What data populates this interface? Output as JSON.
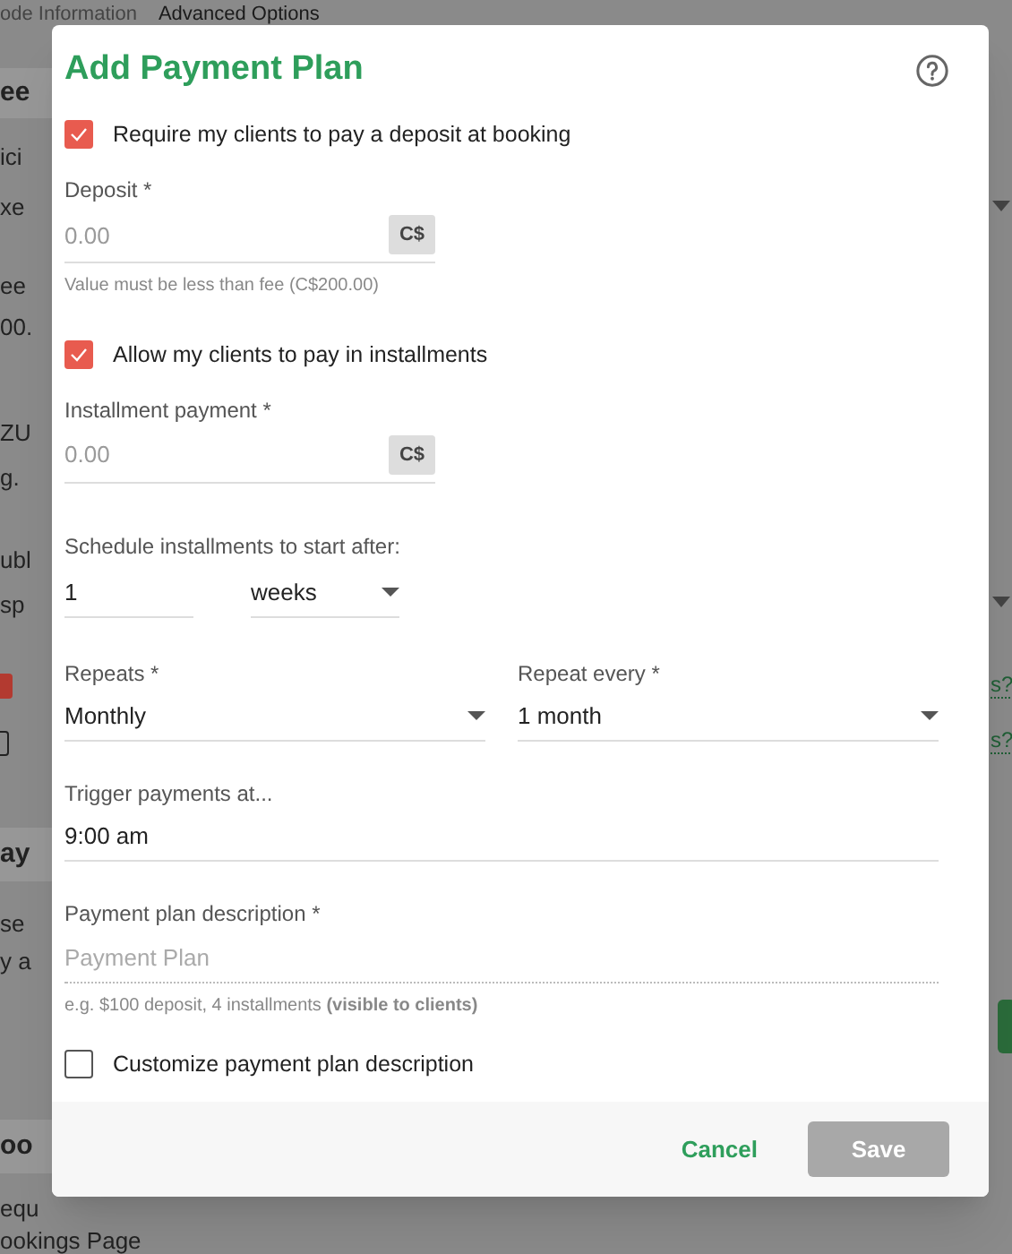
{
  "background": {
    "tabs": [
      {
        "label": "ode Information",
        "selected": false
      },
      {
        "label": "Advanced Options",
        "selected": true
      }
    ],
    "left_fragments": [
      {
        "kind": "heading",
        "text": "ee"
      },
      {
        "kind": "text",
        "text": "ici"
      },
      {
        "kind": "text",
        "text": "xe"
      },
      {
        "kind": "text",
        "text": "ee"
      },
      {
        "kind": "text",
        "text": "00."
      },
      {
        "kind": "text",
        "text": "ZU"
      },
      {
        "kind": "text",
        "text": "g."
      },
      {
        "kind": "text",
        "text": "ubl"
      },
      {
        "kind": "text",
        "text": "sp"
      },
      {
        "kind": "heading",
        "text": "ay"
      },
      {
        "kind": "text",
        "text": "se"
      },
      {
        "kind": "text",
        "text": "y a"
      },
      {
        "kind": "heading",
        "text": "oo"
      },
      {
        "kind": "text",
        "text": "equ"
      },
      {
        "kind": "text",
        "text": "ookings Page"
      }
    ],
    "right_links": [
      "s?",
      "s?"
    ],
    "checkbox": {
      "checked": false
    }
  },
  "dialog": {
    "title": "Add Payment Plan",
    "fields": [
      {
        "kind": "checkbox",
        "label": "Require my clients to pay a deposit at booking",
        "checked": true
      },
      {
        "kind": "money",
        "label": "Deposit *",
        "placeholder": "0.00",
        "currency": "C$",
        "hint": "Value must be less than fee (C$200.00)"
      },
      {
        "kind": "checkbox",
        "label": "Allow my clients to pay in installments",
        "checked": true
      },
      {
        "kind": "money",
        "label": "Installment payment *",
        "placeholder": "0.00",
        "currency": "C$"
      },
      {
        "kind": "delay",
        "label": "Schedule installments to start after:",
        "value": "1",
        "unit": "weeks"
      },
      {
        "kind": "select_pair",
        "selects": [
          {
            "label": "Repeats *",
            "value": "Monthly"
          },
          {
            "label": "Repeat every *",
            "value": "1 month"
          }
        ]
      },
      {
        "kind": "text",
        "label": "Trigger payments at...",
        "value": "9:00 am"
      },
      {
        "kind": "description",
        "label": "Payment plan description *",
        "placeholder": "Payment Plan",
        "hint": "e.g. $100 deposit, 4 installments **(visible to clients)**"
      },
      {
        "kind": "checkbox",
        "label": "Customize payment plan description",
        "checked": false
      }
    ],
    "buttons": [
      {
        "label": "Cancel",
        "kind": "text",
        "disabled": false
      },
      {
        "label": "Save",
        "kind": "filled",
        "disabled": true
      }
    ]
  }
}
